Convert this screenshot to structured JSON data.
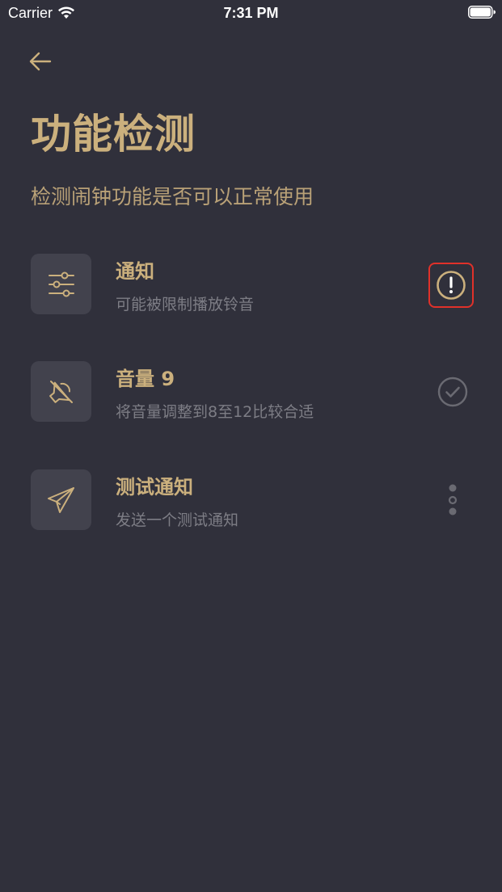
{
  "status_bar": {
    "carrier": "Carrier",
    "time": "7:31 PM"
  },
  "header": {
    "title": "功能检测",
    "subtitle": "检测闹钟功能是否可以正常使用"
  },
  "items": [
    {
      "title": "通知",
      "description": "可能被限制播放铃音",
      "icon": "sliders-icon",
      "status": "warning"
    },
    {
      "title": "音量 9",
      "description": "将音量调整到8至12比较合适",
      "icon": "speaker-muted-icon",
      "status": "ok"
    },
    {
      "title": "测试通知",
      "description": "发送一个测试通知",
      "icon": "paper-plane-icon",
      "status": "more"
    }
  ],
  "colors": {
    "background": "#30303b",
    "accent": "#cbb07d",
    "card": "#42424d",
    "muted": "#7d7d85",
    "alert_border": "#e0312a"
  }
}
